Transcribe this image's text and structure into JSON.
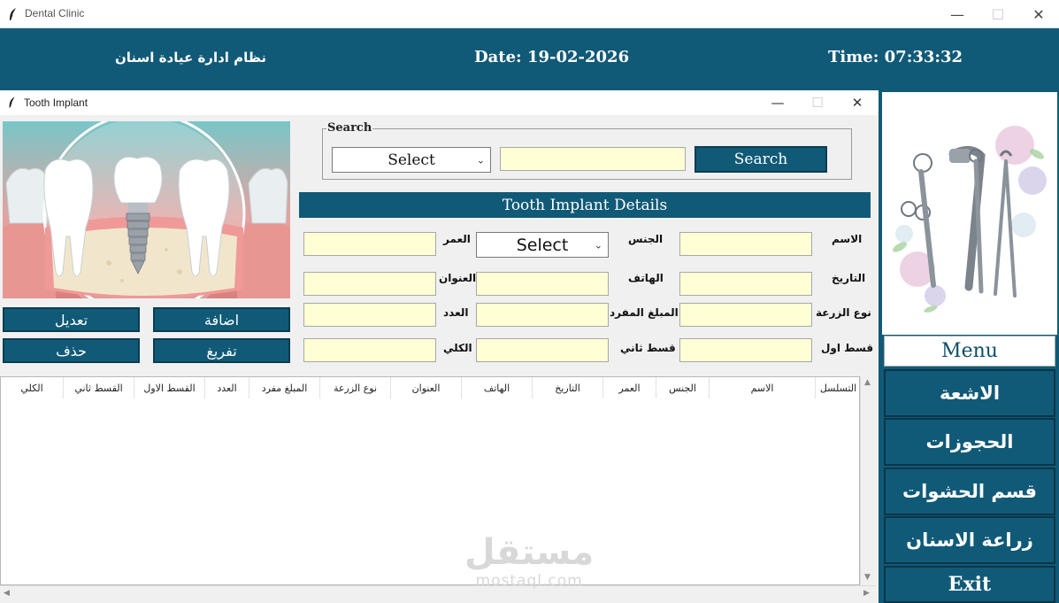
{
  "window": {
    "title": "Dental Clinic",
    "minimize_glyph": "—",
    "maximize_glyph": "☐",
    "close_glyph": "✕"
  },
  "header": {
    "title": "نظام ادارة عيادة اسنان",
    "date": "Date: 19-02-2026",
    "time": "Time: 07:33:32"
  },
  "child_window": {
    "title": "Tooth Implant",
    "minimize_glyph": "—",
    "maximize_glyph": "☐",
    "close_glyph": "✕"
  },
  "actions": {
    "edit": "تعديل",
    "add": "اضافة",
    "delete": "حذف",
    "clear": "تفريغ"
  },
  "search": {
    "legend": "Search",
    "select_value": "Select",
    "query_value": "",
    "button": "Search"
  },
  "details": {
    "heading": "Tooth Implant Details",
    "labels": {
      "name": "الاسم",
      "gender": "الجنس",
      "age": "العمر",
      "date": "التاريخ",
      "phone": "الهاتف",
      "address": "العنوان",
      "implant_type": "نوع الزرعة",
      "unit_price": "المبلغ المفرد",
      "count": "العدد",
      "installment1": "قسط اول",
      "installment2": "قسط ثاني",
      "total": "الكلي"
    },
    "gender_value": "Select",
    "values": {
      "name": "",
      "age": "",
      "date": "",
      "phone": "",
      "address": "",
      "implant_type": "",
      "unit_price": "",
      "count": "",
      "installment1": "",
      "installment2": "",
      "total": ""
    }
  },
  "table": {
    "columns": [
      "التسلسل",
      "الاسم",
      "الجنس",
      "العمر",
      "التاريخ",
      "الهاتف",
      "العنوان",
      "نوع الزرعة",
      "المبلغ مفرد",
      "العدد",
      "القسط الاول",
      "القسط ثاني",
      "الكلي"
    ],
    "rows": []
  },
  "watermark": {
    "arabic": "مستقل",
    "latin": "mostaql.com"
  },
  "menu": {
    "label": "Menu",
    "items": [
      "الاشعة",
      "الحجوزات",
      "قسم الحشوات",
      "زراعة الاسنان",
      "Exit"
    ]
  },
  "colors": {
    "primary": "#115a77",
    "field": "#fffed5",
    "background": "#f0f0f0"
  }
}
